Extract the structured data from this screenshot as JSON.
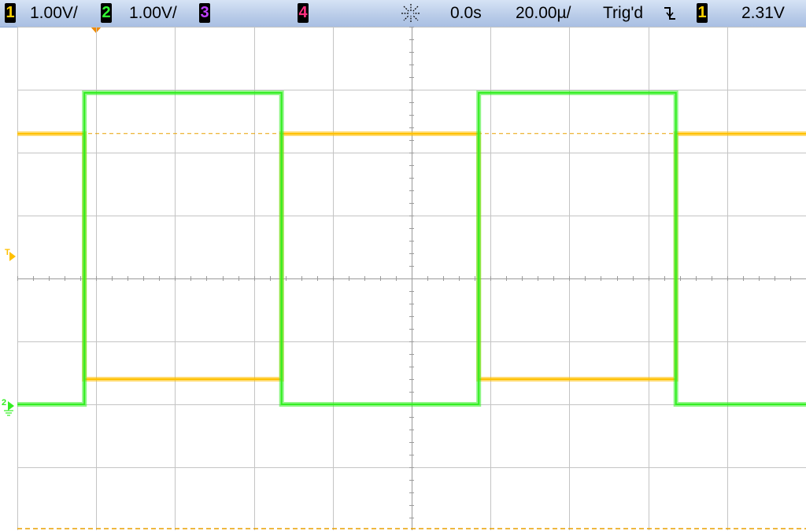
{
  "status_bar": {
    "channels": [
      {
        "num": "1",
        "scale": "1.00V/",
        "color": "#ffd000"
      },
      {
        "num": "2",
        "scale": "1.00V/",
        "color": "#33ff33"
      },
      {
        "num": "3",
        "scale": "",
        "color": "#c040ff"
      },
      {
        "num": "4",
        "scale": "",
        "color": "#ff3080"
      }
    ],
    "run_icon": "starburst-icon",
    "time_offset": "0.0s",
    "timebase": "20.00µ/",
    "trigger_status": "Trig'd",
    "trigger_slope_icon": "falling-edge-icon",
    "trigger_source": "1",
    "trigger_level": "2.31V"
  },
  "markers": {
    "trigger_marker_label": "T",
    "ch2_ground_label": "2"
  },
  "colors": {
    "ch1": "#ffc000",
    "ch2": "#33ee22",
    "grid": "#c4c4c4",
    "trigger_level_line": "#e8a000"
  },
  "chart_data": {
    "type": "line",
    "title": "",
    "xlabel": "",
    "ylabel": "",
    "x_unit": "us",
    "y_unit": "V",
    "xlim": [
      -100,
      100
    ],
    "ylim": [
      -4,
      4
    ],
    "divisions": {
      "x": 10,
      "y": 8
    },
    "grid": true,
    "series": [
      {
        "channel": "1",
        "color": "#ffc000",
        "offset_div": 0,
        "x": [
          -100,
          -83,
          -83,
          -33,
          -33,
          17,
          17,
          67,
          67,
          100
        ],
        "y": [
          2.3,
          2.3,
          -1.6,
          -1.6,
          2.3,
          2.3,
          -1.6,
          -1.6,
          2.3,
          2.3
        ]
      },
      {
        "channel": "2",
        "color": "#33ee22",
        "offset_div": -2,
        "x": [
          -100,
          -83,
          -83,
          -33,
          -33,
          17,
          17,
          67,
          67,
          100
        ],
        "y": [
          0,
          0,
          4.95,
          4.95,
          0,
          0,
          4.95,
          4.95,
          0,
          0
        ]
      }
    ],
    "trigger_level_v": 2.31
  }
}
